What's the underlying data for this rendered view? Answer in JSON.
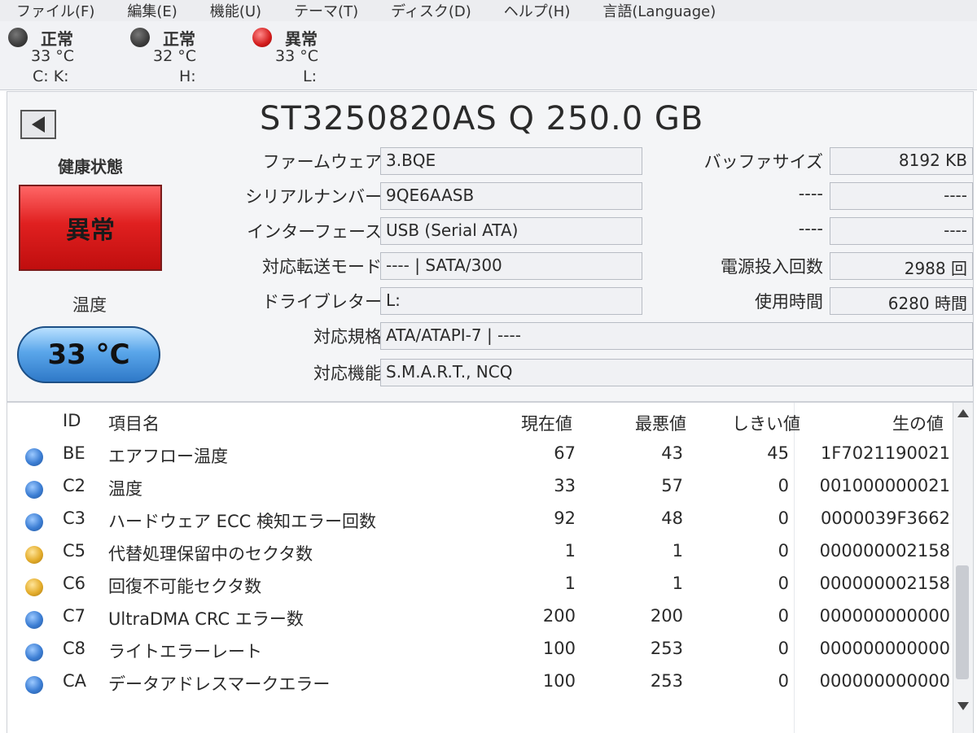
{
  "menu": [
    "ファイル(F)",
    "編集(E)",
    "機能(U)",
    "テーマ(T)",
    "ディスク(D)",
    "ヘルプ(H)",
    "言語(Language)"
  ],
  "disks": [
    {
      "status": "正常",
      "temp": "33 °C",
      "letters": "C: K:",
      "state": "normal"
    },
    {
      "status": "正常",
      "temp": "32 °C",
      "letters": "H:",
      "state": "normal"
    },
    {
      "status": "異常",
      "temp": "33 °C",
      "letters": "L:",
      "state": "alert"
    }
  ],
  "title": "ST3250820AS Q 250.0 GB",
  "health": {
    "label": "健康状態",
    "value": "異常",
    "color": "#e02020"
  },
  "temperature": {
    "label": "温度",
    "value": "33 °C",
    "color": "#4a93dd"
  },
  "info": {
    "firmware": {
      "label": "ファームウェア",
      "value": "3.BQE"
    },
    "serial": {
      "label": "シリアルナンバー",
      "value": "9QE6AASB"
    },
    "interface": {
      "label": "インターフェース",
      "value": "USB (Serial ATA)"
    },
    "transfer": {
      "label": "対応転送モード",
      "value": "---- | SATA/300"
    },
    "drive_letter": {
      "label": "ドライブレター",
      "value": "L:"
    },
    "standard": {
      "label": "対応規格",
      "value": "ATA/ATAPI-7 | ----"
    },
    "features": {
      "label": "対応機能",
      "value": "S.M.A.R.T., NCQ"
    },
    "buffer": {
      "label": "バッファサイズ",
      "value": "8192 KB"
    },
    "blank1": {
      "label": "----",
      "value": "----"
    },
    "blank2": {
      "label": "----",
      "value": "----"
    },
    "power_on_count": {
      "label": "電源投入回数",
      "value": "2988 回"
    },
    "power_on_hours": {
      "label": "使用時間",
      "value": "6280 時間"
    }
  },
  "smart": {
    "headers": {
      "id": "ID",
      "name": "項目名",
      "current": "現在値",
      "worst": "最悪値",
      "threshold": "しきい値",
      "raw": "生の値"
    },
    "rows": [
      {
        "id": "BE",
        "name": "エアフロー温度",
        "current": "67",
        "worst": "43",
        "threshold": "45",
        "raw": "1F7021190021",
        "status": "blue"
      },
      {
        "id": "C2",
        "name": "温度",
        "current": "33",
        "worst": "57",
        "threshold": "0",
        "raw": "001000000021",
        "status": "blue"
      },
      {
        "id": "C3",
        "name": "ハードウェア ECC 検知エラー回数",
        "current": "92",
        "worst": "48",
        "threshold": "0",
        "raw": "0000039F3662",
        "status": "blue"
      },
      {
        "id": "C5",
        "name": "代替処理保留中のセクタ数",
        "current": "1",
        "worst": "1",
        "threshold": "0",
        "raw": "000000002158",
        "status": "amber"
      },
      {
        "id": "C6",
        "name": "回復不可能セクタ数",
        "current": "1",
        "worst": "1",
        "threshold": "0",
        "raw": "000000002158",
        "status": "amber"
      },
      {
        "id": "C7",
        "name": "UltraDMA CRC エラー数",
        "current": "200",
        "worst": "200",
        "threshold": "0",
        "raw": "000000000000",
        "status": "blue"
      },
      {
        "id": "C8",
        "name": "ライトエラーレート",
        "current": "100",
        "worst": "253",
        "threshold": "0",
        "raw": "000000000000",
        "status": "blue"
      },
      {
        "id": "CA",
        "name": "データアドレスマークエラー",
        "current": "100",
        "worst": "253",
        "threshold": "0",
        "raw": "000000000000",
        "status": "blue"
      }
    ]
  }
}
